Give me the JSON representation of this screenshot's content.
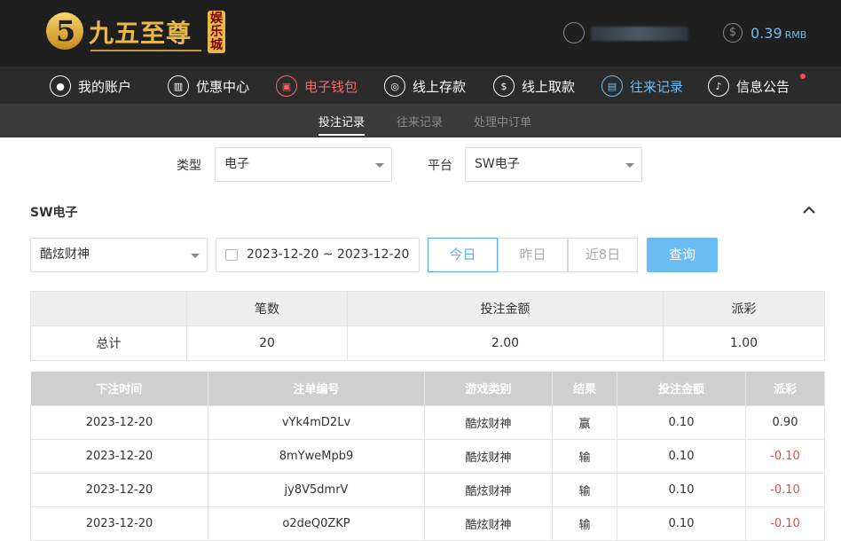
{
  "brand": {
    "name": "九五至尊",
    "badge": "娱乐城"
  },
  "account": {
    "balance": "0.39",
    "currency": "RMB"
  },
  "nav": [
    {
      "label": "我的账户",
      "icon": "user-icon"
    },
    {
      "label": "优惠中心",
      "icon": "gift-icon"
    },
    {
      "label": "电子钱包",
      "icon": "wallet-icon"
    },
    {
      "label": "线上存款",
      "icon": "deposit-icon"
    },
    {
      "label": "线上取款",
      "icon": "withdraw-icon"
    },
    {
      "label": "往来记录",
      "icon": "record-icon"
    },
    {
      "label": "信息公告",
      "icon": "bell-icon"
    }
  ],
  "subnav": [
    "投注记录",
    "往来记录",
    "处理中订单"
  ],
  "filters": {
    "type_label": "类型",
    "type_value": "电子",
    "platform_label": "平台",
    "platform_value": "SW电子"
  },
  "section": {
    "title": "SW电子"
  },
  "query": {
    "game": "酷炫财神",
    "date_range": "2023-12-20 ~ 2023-12-20",
    "ranges": [
      "今日",
      "昨日",
      "近8日"
    ],
    "button": "查询"
  },
  "summary": {
    "headers": [
      "",
      "笔数",
      "投注金额",
      "派彩"
    ],
    "row": [
      "总计",
      "20",
      "2.00",
      "1.00"
    ]
  },
  "records": {
    "headers": [
      "下注时间",
      "注单编号",
      "游戏类别",
      "结果",
      "投注金额",
      "派彩"
    ],
    "rows": [
      [
        "2023-12-20",
        "vYk4mD2Lv",
        "酷炫财神",
        "赢",
        "0.10",
        "0.90"
      ],
      [
        "2023-12-20",
        "8mYweMpb9",
        "酷炫财神",
        "输",
        "0.10",
        "-0.10"
      ],
      [
        "2023-12-20",
        "jy8V5dmrV",
        "酷炫财神",
        "输",
        "0.10",
        "-0.10"
      ],
      [
        "2023-12-20",
        "o2deQ0ZKP",
        "酷炫财神",
        "输",
        "0.10",
        "-0.10"
      ]
    ]
  }
}
